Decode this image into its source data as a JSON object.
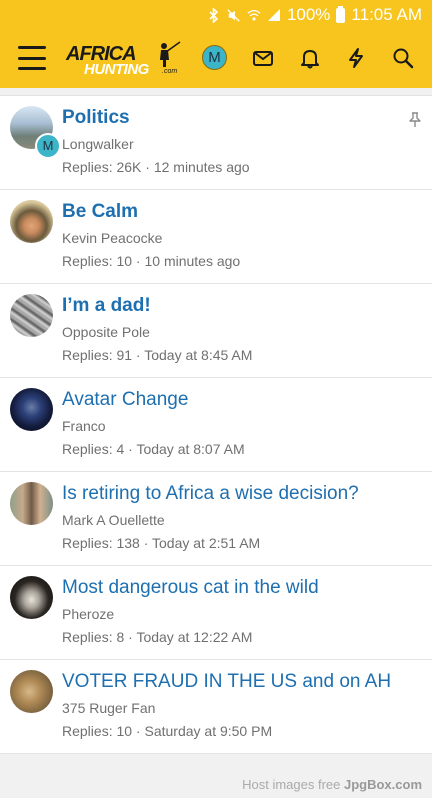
{
  "statusbar": {
    "battery": "100%",
    "time": "11:05 AM",
    "icons": [
      "bluetooth-icon",
      "mute-icon",
      "wifi-icon",
      "signal-icon",
      "battery-icon"
    ]
  },
  "appbar": {
    "logo_top": "AFRICA",
    "logo_bottom": "HUNTING",
    "logo_suffix": ".com",
    "user_initial": "M",
    "icons": [
      "menu-icon",
      "inbox-icon",
      "bell-icon",
      "bolt-icon",
      "search-icon"
    ]
  },
  "threads": [
    {
      "title": "Politics",
      "bold": true,
      "author": "Longwalker",
      "meta": "Replies: 26K · 12 minutes ago",
      "pinned": true,
      "mini": "M"
    },
    {
      "title": "Be Calm",
      "bold": true,
      "author": "Kevin Peacocke",
      "meta": "Replies: 10 · 10 minutes ago"
    },
    {
      "title": "I’m a dad!",
      "bold": true,
      "author": "Opposite Pole",
      "meta": "Replies: 91 · Today at 8:45 AM"
    },
    {
      "title": "Avatar Change",
      "bold": false,
      "author": "Franco",
      "meta": "Replies: 4 · Today at 8:07 AM"
    },
    {
      "title": "Is retiring to Africa a wise decision?",
      "bold": false,
      "author": "Mark A Ouellette",
      "meta": "Replies: 138 · Today at 2:51 AM"
    },
    {
      "title": "Most dangerous cat in the wild",
      "bold": false,
      "author": "Pheroze",
      "meta": "Replies: 8 · Today at 12:22 AM"
    },
    {
      "title": "VOTER FRAUD IN THE US and on AH",
      "bold": false,
      "author": "375 Ruger Fan",
      "meta": "Replies: 10 · Saturday at 9:50 PM"
    }
  ],
  "watermark": {
    "text": "Host images free ",
    "brand": "JpgBox.com"
  },
  "colors": {
    "accent": "#f7c51e",
    "link": "#1e6fb0",
    "muted": "#707070"
  }
}
